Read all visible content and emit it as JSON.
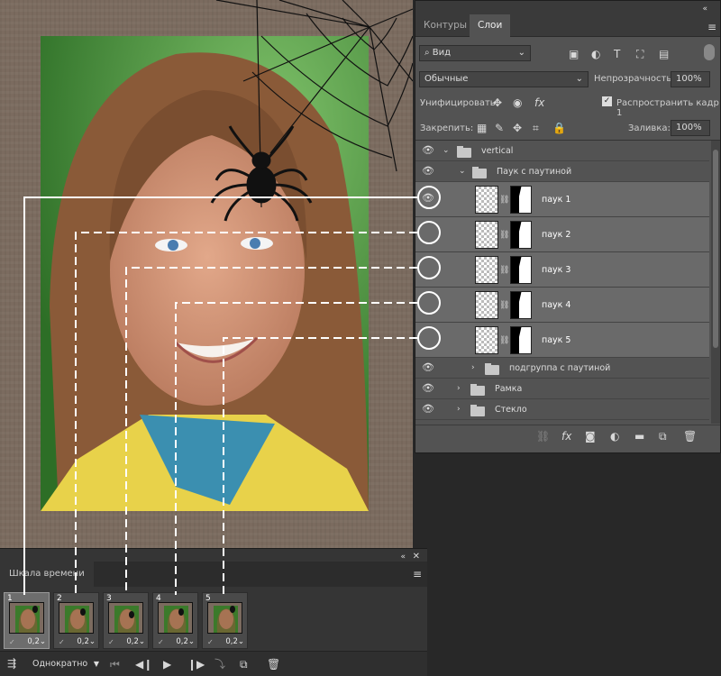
{
  "layers_panel": {
    "tabs": [
      "Контуры",
      "Слои"
    ],
    "active_tab": "Слои",
    "filter_label": "Вид",
    "blend_mode": "Обычные",
    "opacity_label": "Непрозрачность:",
    "opacity_value": "100%",
    "unify_label": "Унифицировать:",
    "propagate_label": "Распространить кадр 1",
    "lock_label": "Закрепить:",
    "fill_label": "Заливка:",
    "fill_value": "100%",
    "layers": [
      {
        "name": "vertical",
        "type": "group",
        "indent": 0,
        "visible": true,
        "expanded": true
      },
      {
        "name": "Паук с паутиной",
        "type": "group",
        "indent": 1,
        "visible": true,
        "expanded": true
      },
      {
        "name": "паук 1",
        "type": "layer",
        "indent": 2,
        "visible": true
      },
      {
        "name": "паук 2",
        "type": "layer",
        "indent": 2,
        "visible": false
      },
      {
        "name": "паук 3",
        "type": "layer",
        "indent": 2,
        "visible": false
      },
      {
        "name": "паук 4",
        "type": "layer",
        "indent": 2,
        "visible": false
      },
      {
        "name": "паук 5",
        "type": "layer",
        "indent": 2,
        "visible": false
      },
      {
        "name": "подгруппа с паутиной",
        "type": "group",
        "indent": 1,
        "visible": true,
        "expanded": false
      },
      {
        "name": "Рамка",
        "type": "group",
        "indent": 0,
        "visible": true,
        "expanded": false
      },
      {
        "name": "Стекло",
        "type": "group",
        "indent": 0,
        "visible": true,
        "expanded": false
      }
    ],
    "bottom_icons": [
      "link-icon",
      "fx-icon",
      "mask-icon",
      "adjustment-icon",
      "folder-icon",
      "new-layer-icon",
      "trash-icon"
    ]
  },
  "timeline": {
    "title": "Шкала времени",
    "frames": [
      {
        "number": "1",
        "delay": "0,2"
      },
      {
        "number": "2",
        "delay": "0,2"
      },
      {
        "number": "3",
        "delay": "0,2"
      },
      {
        "number": "4",
        "delay": "0,2"
      },
      {
        "number": "5",
        "delay": "0,2"
      }
    ],
    "selected_frame": 1,
    "loop_option": "Однократно"
  },
  "colors": {
    "panel": "#535353",
    "selected_layer": "#6a6a6a",
    "overlay_line": "#ffffff"
  }
}
